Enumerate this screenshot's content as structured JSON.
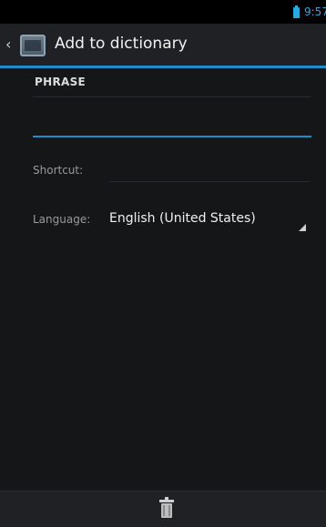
{
  "status_bar": {
    "time": "9:57",
    "battery_icon": "battery-icon",
    "accent_color": "#2aa8dc"
  },
  "action_bar": {
    "back_icon": "chevron-left-icon",
    "app_icon": "dictionary-app-icon",
    "title": "Add to dictionary"
  },
  "form": {
    "phrase_label": "PHRASE",
    "phrase_value": "",
    "shortcut_label": "Shortcut:",
    "shortcut_value": "",
    "language_label": "Language:",
    "language_value": "English (United States)"
  },
  "bottom_bar": {
    "delete_icon": "trash-icon"
  },
  "colors": {
    "accent": "#1d8fc4",
    "background": "#151618",
    "bar": "#202124"
  }
}
